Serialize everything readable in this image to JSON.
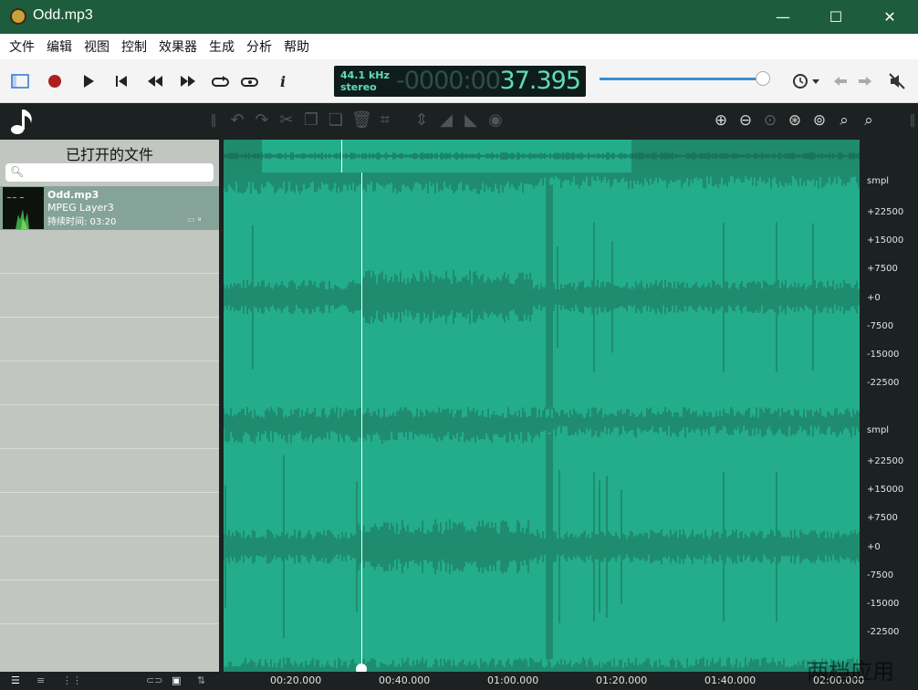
{
  "window": {
    "title": "Odd.mp3",
    "min_glyph": "—",
    "max_glyph": "☐",
    "close_glyph": "✕"
  },
  "menu": [
    "文件",
    "编辑",
    "视图",
    "控制",
    "效果器",
    "生成",
    "分析",
    "帮助"
  ],
  "transport": {
    "sample_rate": "44.1 kHz",
    "channels": "stereo",
    "time_placeholder": "-0000:00",
    "time": "37.395",
    "volume_fraction": 0.96
  },
  "sidebar": {
    "title": "已打开的文件",
    "search_placeholder": "",
    "files": [
      {
        "name": "Odd.mp3",
        "type": "MPEG Layer3",
        "duration": "持续时间: 03:20"
      }
    ]
  },
  "ruler": {
    "top_channel": [
      "smpl",
      "+22500",
      "+15000",
      "+7500",
      "+0",
      "-7500",
      "-15000",
      "-22500"
    ],
    "bottom_channel": [
      "smpl",
      "+22500",
      "+15000",
      "+7500",
      "+0",
      "-7500",
      "-15000",
      "-22500"
    ]
  },
  "timeline": [
    "00:20.000",
    "00:40.000",
    "01:00.000",
    "01:20.000",
    "01:40.000",
    "02:00.000"
  ],
  "cursor": {
    "time": "00:37.395"
  },
  "watermark": "两档应用",
  "colors": {
    "titlebar": "#1e5c3e",
    "waveform_bg": "#23ad8a",
    "waveform": "#1b6a56",
    "accent": "#5fdcb7"
  }
}
